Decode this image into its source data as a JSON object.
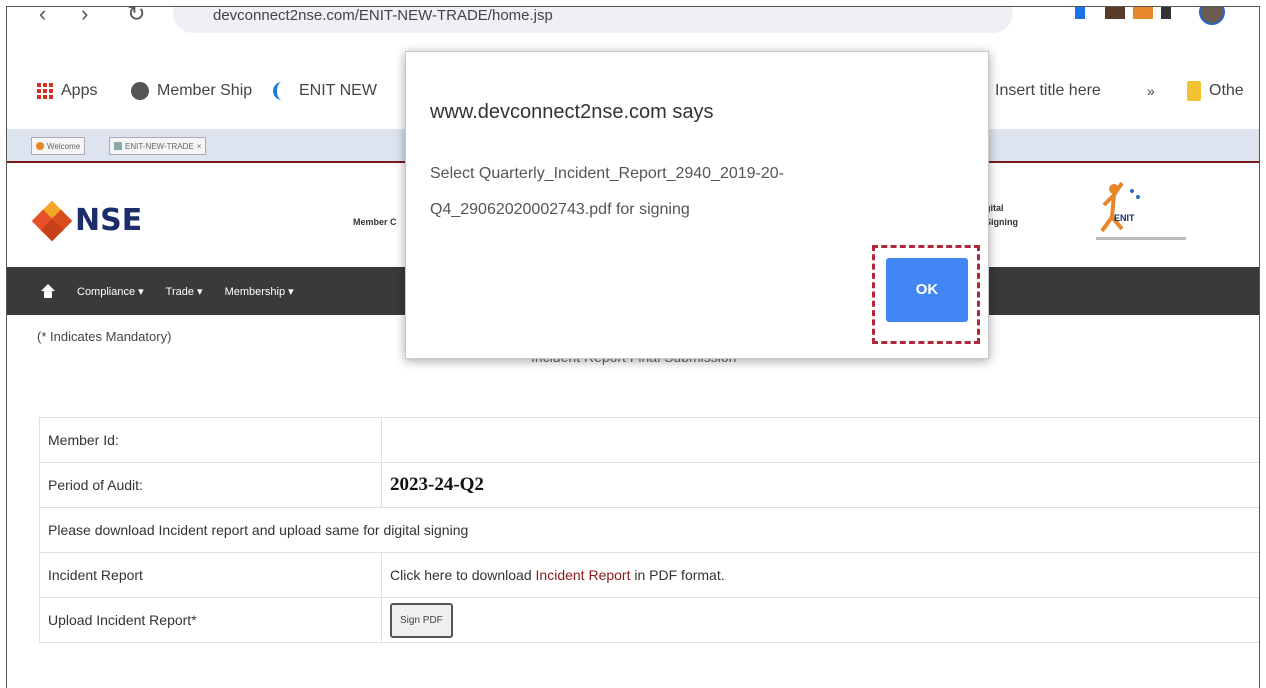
{
  "browser": {
    "url": "devconnect2nse.com/ENIT-NEW-TRADE/home.jsp",
    "bookmarks": [
      {
        "label": "Apps",
        "icon": "apps-grid-icon"
      },
      {
        "label": "Member Ship",
        "icon": "globe-icon"
      },
      {
        "label": "ENIT NEW",
        "icon": "loading-icon"
      },
      {
        "label": "Insert title here",
        "icon": ""
      },
      {
        "label": "»",
        "icon": ""
      },
      {
        "label": "Othe",
        "icon": "folder-icon"
      }
    ],
    "inner_tabs": [
      "Welcome",
      "ENIT-NEW-TRADE"
    ]
  },
  "header": {
    "logo_text": "NSE",
    "member_label": "Member C",
    "digital_signing_label": "gital\nSigning",
    "enit_label": "ENIT"
  },
  "menu": {
    "items": [
      "Compliance ▾",
      "Trade ▾",
      "Membership ▾"
    ]
  },
  "page": {
    "mandatory_note": "(* Indicates Mandatory)",
    "title_partial": "Incident Report Final Submission"
  },
  "form": {
    "rows": [
      {
        "label": "Member Id:",
        "value": ""
      },
      {
        "label": "Period of Audit:",
        "value": "2023-24-Q2"
      },
      {
        "label": "Please download Incident report and upload same for digital signing",
        "value": ""
      },
      {
        "label": "Incident Report",
        "value_prefix": "Click here to download ",
        "value_link": "Incident Report",
        "value_suffix": " in PDF format."
      },
      {
        "label": "Upload Incident Report*",
        "button": "Sign PDF"
      }
    ]
  },
  "dialog": {
    "title": "www.devconnect2nse.com says",
    "message_line1": "Select Quarterly_Incident_Report_2940_2019-20-",
    "message_line2": "Q4_29062020002743.pdf for signing",
    "ok_label": "OK"
  },
  "colors": {
    "accent": "#4285f4",
    "menubar": "#3a3a3a",
    "highlight": "#b0283a",
    "nse_blue": "#1c2d6b"
  }
}
